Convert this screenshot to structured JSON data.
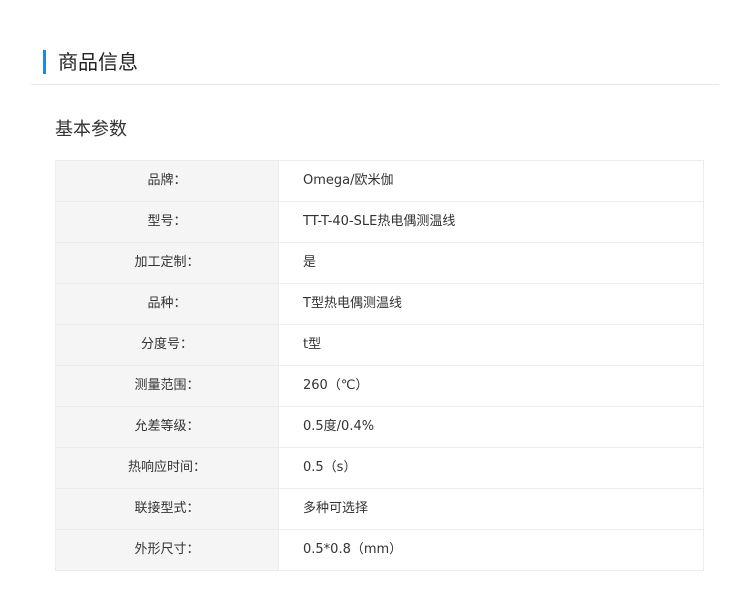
{
  "section": {
    "title": "商品信息",
    "accent_color": "#1e88e5"
  },
  "params": {
    "subtitle": "基本参数",
    "rows": [
      {
        "label": "品牌：",
        "value": "Omega/欧米伽"
      },
      {
        "label": "型号：",
        "value": "TT-T-40-SLE热电偶测温线"
      },
      {
        "label": "加工定制：",
        "value": "是"
      },
      {
        "label": "品种：",
        "value": "T型热电偶测温线"
      },
      {
        "label": "分度号：",
        "value": "t型"
      },
      {
        "label": "测量范围：",
        "value": "260（℃）"
      },
      {
        "label": "允差等级：",
        "value": "0.5度/0.4%"
      },
      {
        "label": "热响应时间：",
        "value": "0.5（s）"
      },
      {
        "label": "联接型式：",
        "value": "多种可选择"
      },
      {
        "label": "外形尺寸：",
        "value": "0.5*0.8（mm）"
      }
    ]
  }
}
